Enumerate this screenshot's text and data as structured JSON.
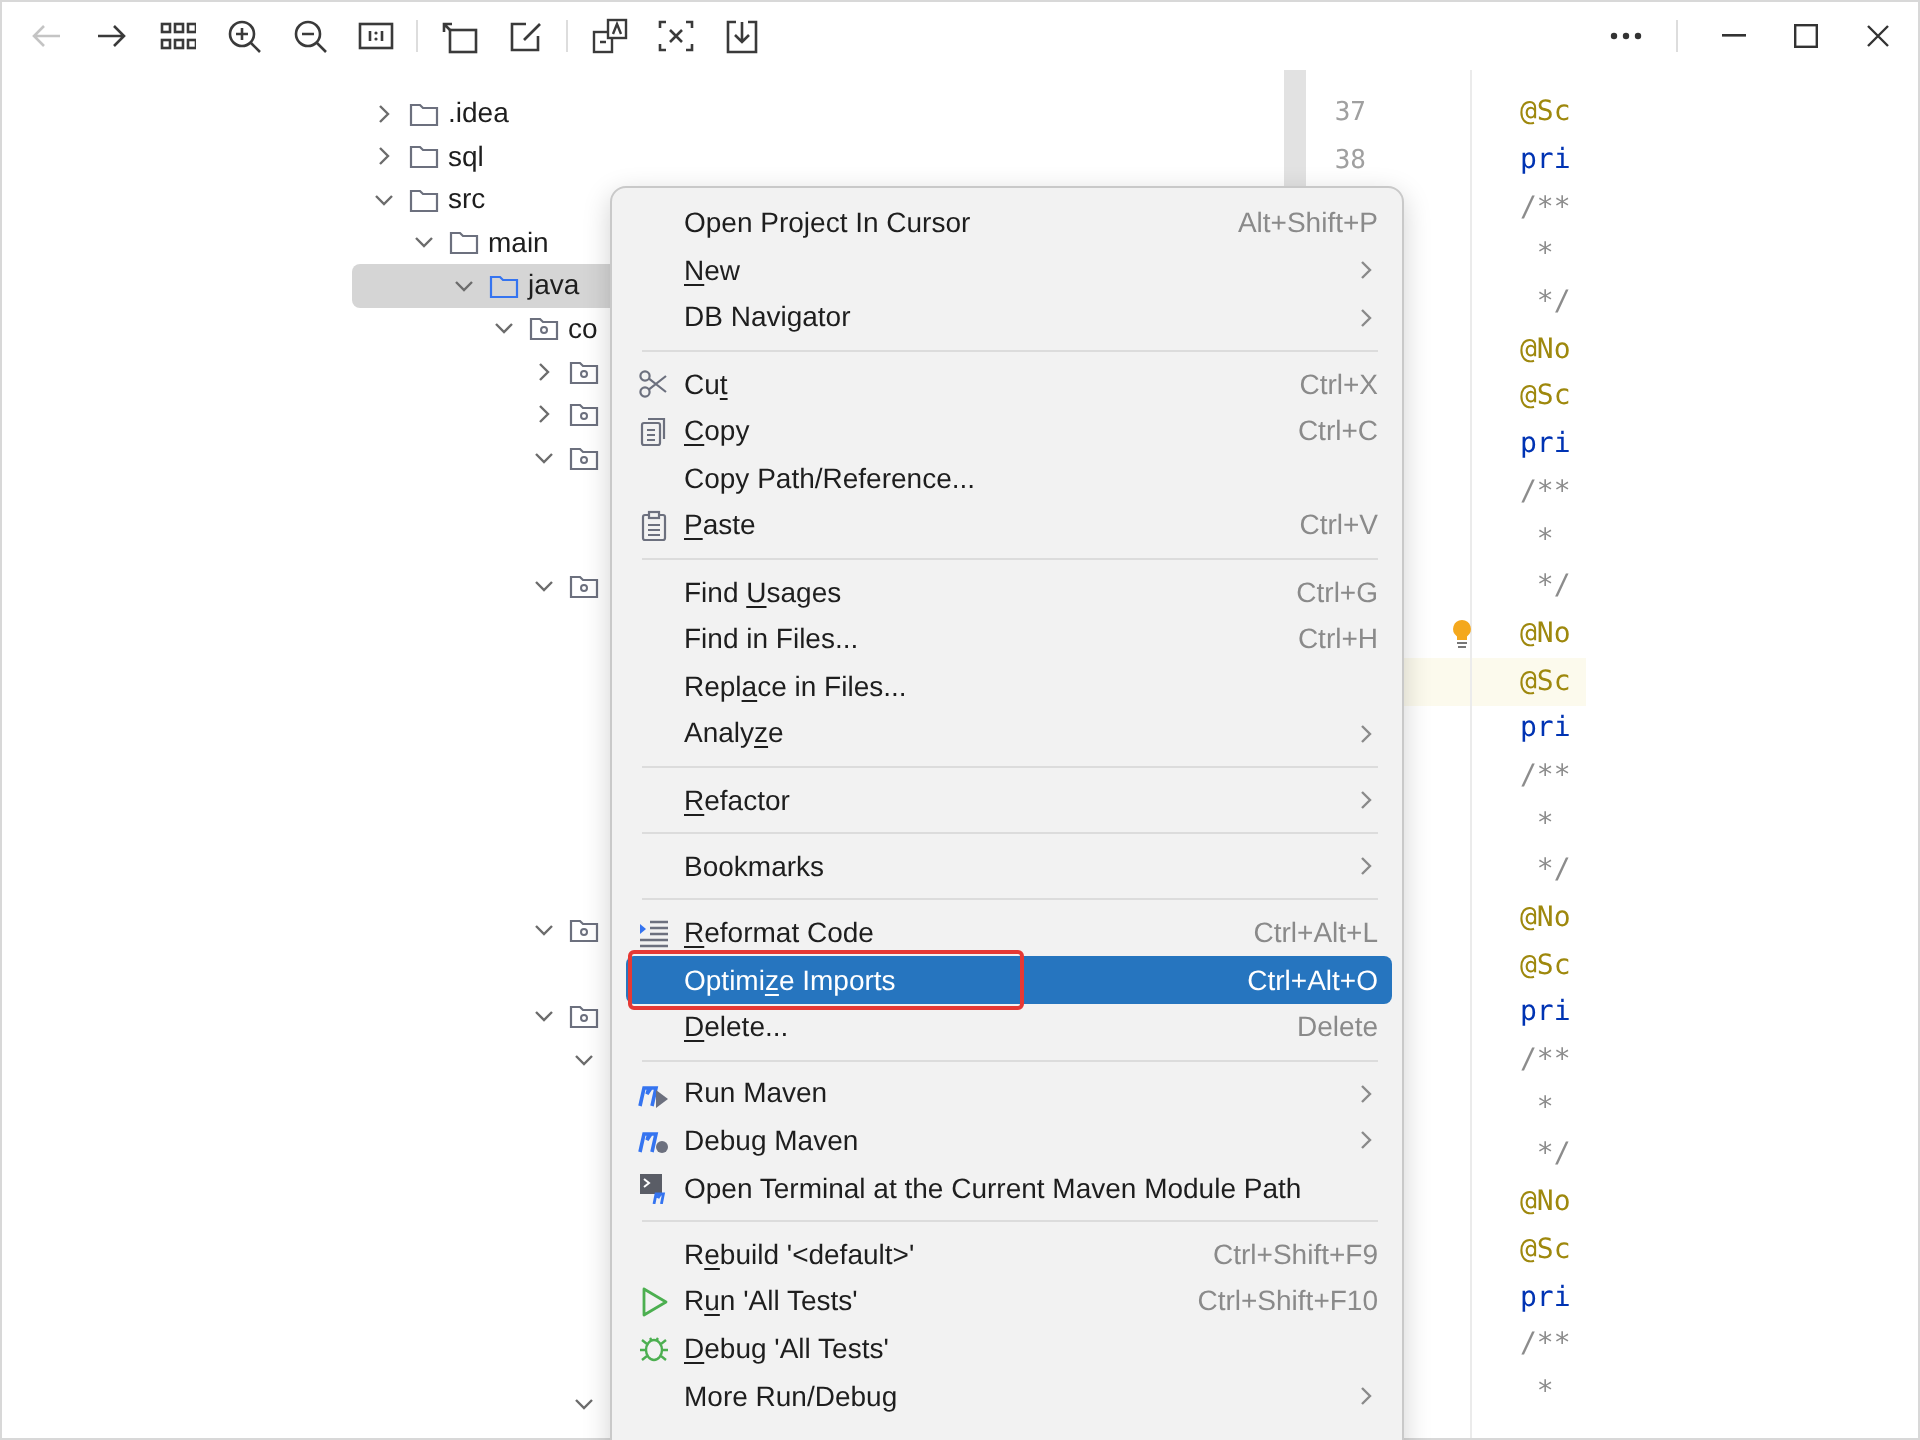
{
  "toolbar": {
    "buttons": [
      {
        "kind": "back",
        "disabled": true
      },
      {
        "kind": "forward",
        "disabled": false
      },
      {
        "kind": "grid",
        "disabled": false
      },
      {
        "kind": "zoom-in",
        "disabled": false
      },
      {
        "kind": "zoom-out",
        "disabled": false
      },
      {
        "kind": "actual-size",
        "disabled": false
      },
      {
        "kind": "rotate",
        "disabled": false
      },
      {
        "kind": "edit",
        "disabled": false
      },
      {
        "kind": "translate",
        "disabled": false
      },
      {
        "kind": "scan",
        "disabled": false
      },
      {
        "kind": "download",
        "disabled": false
      }
    ]
  },
  "project_tree": {
    "items": [
      {
        "label": ".idea",
        "expanded": false
      },
      {
        "label": "sql",
        "expanded": false
      },
      {
        "label": "src",
        "expanded": true,
        "children": [
          {
            "label": "main",
            "expanded": true,
            "children": [
              {
                "label": "java",
                "expanded": true,
                "selected": true,
                "children": [
                  {
                    "label": "co",
                    "expanded": true,
                    "kind": "package",
                    "children": [
                      {
                        "kind": "package",
                        "expanded": false
                      },
                      {
                        "kind": "package",
                        "expanded": false
                      },
                      {
                        "kind": "package",
                        "expanded": true
                      },
                      {
                        "kind": "package",
                        "expanded": true
                      },
                      {
                        "kind": "package",
                        "expanded": true
                      },
                      {
                        "kind": "package",
                        "expanded": true,
                        "children": [
                          {
                            "expanded": true
                          },
                          {
                            "expanded": true
                          }
                        ]
                      }
                    ]
                  }
                ]
              }
            ]
          }
        ]
      }
    ]
  },
  "gutter": {
    "line_numbers": [
      "37",
      "38"
    ]
  },
  "code_lines": [
    {
      "kind": "annotation",
      "text": "@Sc"
    },
    {
      "kind": "keyword",
      "text": "pri"
    },
    {
      "kind": "comment",
      "text": "/**"
    },
    {
      "kind": "comment",
      "text": " *"
    },
    {
      "kind": "comment",
      "text": " */"
    },
    {
      "kind": "annotation",
      "text": "@No"
    },
    {
      "kind": "annotation",
      "text": "@Sc"
    },
    {
      "kind": "keyword",
      "text": "pri"
    },
    {
      "kind": "comment",
      "text": "/**"
    },
    {
      "kind": "comment",
      "text": " *"
    },
    {
      "kind": "comment",
      "text": " */"
    },
    {
      "kind": "annotation",
      "text": "@No",
      "bulb": true
    },
    {
      "kind": "annotation",
      "text": "@Sc",
      "caret_line": true
    },
    {
      "kind": "keyword",
      "text": "pri"
    },
    {
      "kind": "comment",
      "text": "/**"
    },
    {
      "kind": "comment",
      "text": " *"
    },
    {
      "kind": "comment",
      "text": " */"
    },
    {
      "kind": "annotation",
      "text": "@No"
    },
    {
      "kind": "annotation",
      "text": "@Sc"
    },
    {
      "kind": "keyword",
      "text": "pri"
    },
    {
      "kind": "comment",
      "text": "/**"
    },
    {
      "kind": "comment",
      "text": " *"
    },
    {
      "kind": "comment",
      "text": " */"
    },
    {
      "kind": "annotation",
      "text": "@No"
    },
    {
      "kind": "annotation",
      "text": "@Sc"
    },
    {
      "kind": "keyword",
      "text": "pri"
    },
    {
      "kind": "comment",
      "text": "/**"
    },
    {
      "kind": "comment",
      "text": " *"
    }
  ],
  "context_menu": {
    "items": [
      {
        "kind": "item",
        "label": "Open Project In Cursor",
        "shortcut": "Alt+Shift+P",
        "selected": false
      },
      {
        "kind": "item",
        "label": "New",
        "submenu": true,
        "selected": false
      },
      {
        "kind": "item",
        "label": "DB Navigator",
        "submenu": true,
        "selected": false
      },
      {
        "kind": "separator"
      },
      {
        "kind": "item",
        "label": "Cut",
        "shortcut": "Ctrl+X",
        "selected": false
      },
      {
        "kind": "item",
        "label": "Copy",
        "shortcut": "Ctrl+C",
        "selected": false
      },
      {
        "kind": "item",
        "label": "Copy Path/Reference...",
        "selected": false
      },
      {
        "kind": "item",
        "label": "Paste",
        "shortcut": "Ctrl+V",
        "selected": false
      },
      {
        "kind": "separator"
      },
      {
        "kind": "item",
        "label": "Find Usages",
        "shortcut": "Ctrl+G",
        "selected": false
      },
      {
        "kind": "item",
        "label": "Find in Files...",
        "shortcut": "Ctrl+H",
        "selected": false
      },
      {
        "kind": "item",
        "label": "Replace in Files...",
        "selected": false
      },
      {
        "kind": "item",
        "label": "Analyze",
        "submenu": true,
        "selected": false
      },
      {
        "kind": "separator"
      },
      {
        "kind": "item",
        "label": "Refactor",
        "submenu": true,
        "selected": false
      },
      {
        "kind": "separator"
      },
      {
        "kind": "item",
        "label": "Bookmarks",
        "submenu": true,
        "selected": false
      },
      {
        "kind": "separator"
      },
      {
        "kind": "item",
        "label": "Reformat Code",
        "shortcut": "Ctrl+Alt+L",
        "selected": false
      },
      {
        "kind": "item",
        "label": "Optimize Imports",
        "shortcut": "Ctrl+Alt+O",
        "selected": true,
        "annotated": true
      },
      {
        "kind": "item",
        "label": "Delete...",
        "shortcut": "Delete",
        "selected": false
      },
      {
        "kind": "separator"
      },
      {
        "kind": "item",
        "label": "Run Maven",
        "submenu": true,
        "selected": false
      },
      {
        "kind": "item",
        "label": "Debug Maven",
        "submenu": true,
        "selected": false
      },
      {
        "kind": "item",
        "label": "Open Terminal at the Current Maven Module Path",
        "selected": false
      },
      {
        "kind": "separator"
      },
      {
        "kind": "item",
        "label": "Rebuild '<default>'",
        "shortcut": "Ctrl+Shift+F9",
        "selected": false
      },
      {
        "kind": "item",
        "label": "Run 'All Tests'",
        "shortcut": "Ctrl+Shift+F10",
        "selected": false
      },
      {
        "kind": "item",
        "label": "Debug 'All Tests'",
        "selected": false
      },
      {
        "kind": "item",
        "label": "More Run/Debug",
        "submenu": true,
        "selected": false
      }
    ]
  }
}
